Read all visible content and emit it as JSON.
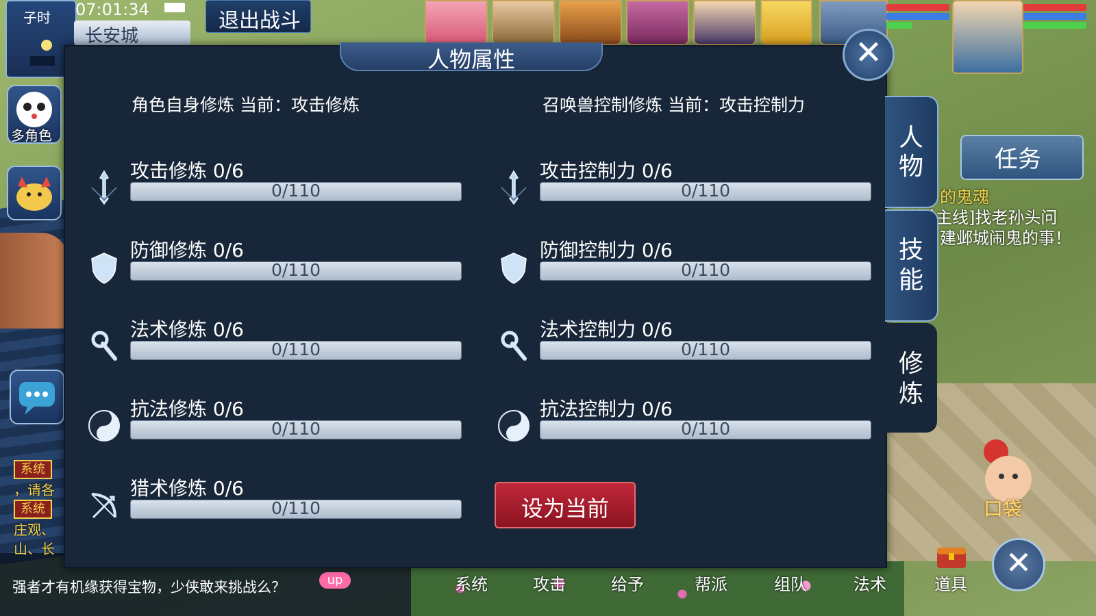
{
  "hud": {
    "time_period": "子时",
    "clock": "07:01:34",
    "city": "长安城",
    "exit_battle": "退出战斗",
    "multi_role": "多角色"
  },
  "dialog": {
    "title": "人物属性",
    "left_header": "角色自身修炼  当前：攻击修炼",
    "right_header": "召唤兽控制修炼  当前：攻击控制力",
    "left_items": [
      {
        "name": "攻击修炼 0/6",
        "progress": "0/110",
        "icon": "sword-icon"
      },
      {
        "name": "防御修炼 0/6",
        "progress": "0/110",
        "icon": "shield-icon"
      },
      {
        "name": "法术修炼 0/6",
        "progress": "0/110",
        "icon": "staff-icon"
      },
      {
        "name": "抗法修炼 0/6",
        "progress": "0/110",
        "icon": "yin-yang-icon"
      },
      {
        "name": "猎术修炼 0/6",
        "progress": "0/110",
        "icon": "bow-icon"
      }
    ],
    "right_items": [
      {
        "name": "攻击控制力 0/6",
        "progress": "0/110",
        "icon": "sword-icon"
      },
      {
        "name": "防御控制力 0/6",
        "progress": "0/110",
        "icon": "shield-icon"
      },
      {
        "name": "法术控制力 0/6",
        "progress": "0/110",
        "icon": "staff-icon"
      },
      {
        "name": "抗法控制力 0/6",
        "progress": "0/110",
        "icon": "yin-yang-icon"
      }
    ],
    "set_current": "设为当前",
    "tabs": [
      "人物",
      "技能",
      "修炼"
    ],
    "active_tab": "修炼"
  },
  "right_panel": {
    "task_button": "任务",
    "quest_lines": [
      "的鬼魂",
      "新手主线]找老孙头问",
      "建邺城闹鬼的事！"
    ]
  },
  "chat": {
    "system_tag": "系统",
    "lines": [
      "，请各",
      "庄观、",
      "山、长"
    ],
    "marquee": "强者才有机缘获得宝物，少侠敢来挑战么？",
    "up_badge": "up"
  },
  "actions": [
    "系统",
    "攻击",
    "给予",
    "帮派",
    "组队",
    "法术",
    "道具"
  ],
  "bag_label": "口袋",
  "colors": {
    "panel_bg": "#172638",
    "progress_track": "#c4d0dd",
    "set_button": "#a81d2c",
    "quest_text": "#ffffff",
    "chat_text": "#f4d34a"
  }
}
